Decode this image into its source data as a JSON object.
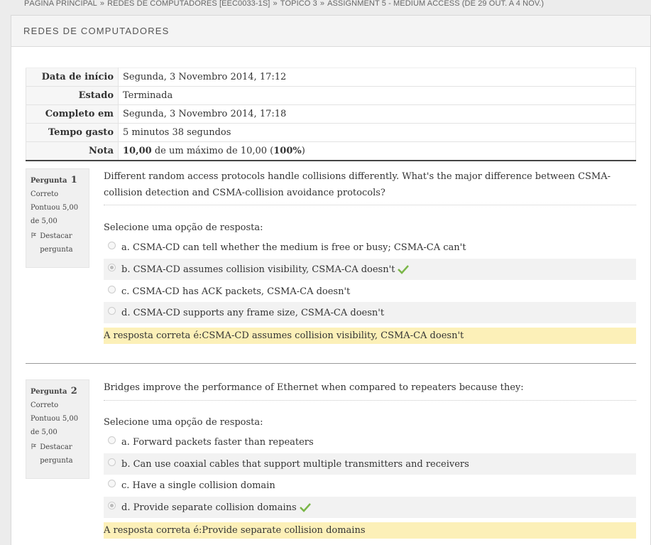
{
  "breadcrumb": [
    "PÁGINA PRINCIPAL",
    "REDES DE COMPUTADORES [EEC0033-1S]",
    "TÓPICO 3",
    "ASSIGNMENT 5 - MEDIUM ACCESS (DE 29 OUT. A 4 NOV.)"
  ],
  "breadcrumb_sep": "»",
  "course_title": "REDES DE COMPUTADORES",
  "summary": [
    {
      "label": "Data de início",
      "value": "Segunda, 3 Novembro 2014, 17:12"
    },
    {
      "label": "Estado",
      "value": "Terminada"
    },
    {
      "label": "Completo em",
      "value": "Segunda, 3 Novembro 2014, 17:18"
    },
    {
      "label": "Tempo gasto",
      "value": "5 minutos 38 segundos"
    },
    {
      "label": "Nota",
      "value_bold": "10,00",
      "value_mid": " de um máximo de 10,00 (",
      "value_pct": "100%",
      "value_end": ")"
    }
  ],
  "questions": [
    {
      "label": "Pergunta",
      "number": "1",
      "state": "Correto",
      "mark": "Pontuou 5,00 de 5,00",
      "flag_label": "Destacar pergunta",
      "text": "Different random access protocols handle collisions differently. What's the major difference between CSMA-collision detection and CSMA-collision avoidance protocols?",
      "prompt": "Selecione uma opção de resposta:",
      "options": [
        "a. CSMA-CD can tell whether the medium is free or busy; CSMA-CA can't",
        "b. CSMA-CD assumes collision visibility, CSMA-CA doesn't",
        "c. CSMA-CD has ACK packets, CSMA-CA doesn't",
        "d. CSMA-CD supports any frame size, CSMA-CA doesn't"
      ],
      "selected": 1,
      "correct_answer": "A resposta correta é:CSMA-CD assumes collision visibility, CSMA-CA doesn't"
    },
    {
      "label": "Pergunta",
      "number": "2",
      "state": "Correto",
      "mark": "Pontuou 5,00 de 5,00",
      "flag_label": "Destacar pergunta",
      "text": "Bridges improve the performance of Ethernet when compared to repeaters because they:",
      "prompt": "Selecione uma opção de resposta:",
      "options": [
        "a. Forward packets faster than repeaters",
        "b. Can use coaxial cables that support multiple transmitters and receivers",
        "c. Have a single collision domain",
        "d. Provide separate collision domains"
      ],
      "selected": 3,
      "correct_answer": "A resposta correta é:Provide separate collision domains"
    }
  ],
  "colors": {
    "correct_bg": "#fcf0b8",
    "check": "#7ab648",
    "accent_divider": "#999999"
  },
  "icons": {
    "flag": "flag-icon",
    "check": "check-icon",
    "radio": "radio-icon"
  }
}
